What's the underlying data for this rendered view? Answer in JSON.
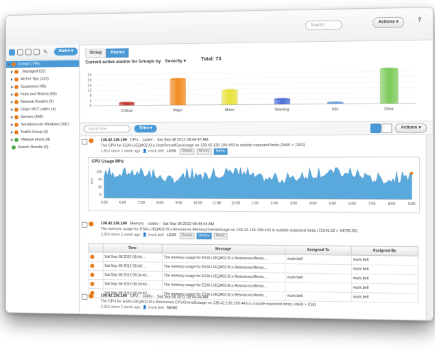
{
  "top": {
    "search_placeholder": "Search",
    "actions_label": "Actions",
    "help_label": "?"
  },
  "left": {
    "name_button": "Name",
    "tree": [
      {
        "label": "Groups (799)",
        "color": "#e67c1e",
        "selected": true
      },
      {
        "label": "_Managed (12)",
        "color": "#e67c1e"
      },
      {
        "label": "All For Tips (332)",
        "color": "#e67c1e"
      },
      {
        "label": "Customers (46)",
        "color": "#e67c1e"
      },
      {
        "label": "Hubs and Robots (55)",
        "color": "#e67c1e"
      },
      {
        "label": "Network Routers (9)",
        "color": "#e67c1e"
      },
      {
        "label": "Origin NOT cadev (4)",
        "color": "#e67c1e"
      },
      {
        "label": "Servers (398)",
        "color": "#e67c1e"
      },
      {
        "label": "Servidores de Windows (301)",
        "color": "#e67c1e"
      },
      {
        "label": "Todd's Group (3)",
        "color": "#e67c1e"
      },
      {
        "label": "VMware Hosts (4)",
        "color": "#4aa84a"
      },
      {
        "label": "Search Results (0)",
        "color": "#4aa84a"
      }
    ]
  },
  "tabs": [
    "Group",
    "Alarms"
  ],
  "chart_title": "Current active alarms for Groups by",
  "severity_label": "Severity",
  "total_label": "Total: 73",
  "chart_data": {
    "type": "bar",
    "categories": [
      "Critical",
      "Major",
      "Minor",
      "Warning",
      "Info",
      "Clear"
    ],
    "values": [
      2,
      20,
      11,
      4,
      1,
      26
    ],
    "colors": [
      "#c0392b",
      "#f08a1e",
      "#e8e23a",
      "#4c6fd8",
      "#6aa2e0",
      "#7ccb5a"
    ],
    "yticks": [
      24,
      20,
      16,
      12,
      8,
      4,
      0
    ],
    "ylim": [
      0,
      28
    ]
  },
  "filter": {
    "placeholder": "Quick Filter",
    "time_button": "Time",
    "actions_label": "Actions"
  },
  "alarms": [
    {
      "ip": "138.42.136.199",
      "type": "CPU",
      "origin": "cadev",
      "time": "Sat Sep 08 2012 08:44:47 AM",
      "message": "The CPU for ESXi-LIEQA02.l9.x.HostOverallCpuUsage on 138.42.136.199:443 is outside expected limits (9460 > 1303)",
      "meta": "2,812 since 1 week ago",
      "user": "mark.bell",
      "buttons": [
        "LESS",
        "Details",
        "History",
        "Metric"
      ]
    },
    {
      "ip": "138.42.136.199",
      "type": "Memory",
      "origin": "cadev",
      "time": "Sat Sep 08 2012 08:44:44 AM",
      "message": "The memory usage for ESXi-LIEQA02.l9.x.Resources.MemoryOverallUsage on 138.42.136.199:443 is outside expected limits (73143.32 > 34796.26)",
      "meta": "2,812 since 1 week ago",
      "user": "mark.bell",
      "buttons": [
        "LESS",
        "Details",
        "History",
        "Metric"
      ]
    },
    {
      "ip": "138.42.136.199",
      "type": "CPU",
      "origin": "cadev",
      "time": "Sat Sep 08 2012 08:44:44 AM",
      "message": "The CPU for ESXi-LIEQA02.l9.x.Resources.CPUOverallUsage on 138.42.136.199:443 is outside expected limits (4840 > 918)",
      "meta": "2,812 since 1 week ago",
      "user": "mark.bell",
      "buttons": [
        "MORE"
      ]
    }
  ],
  "metric": {
    "title": "CPU Usage MHz",
    "ylabel": "MHz",
    "yticks": [
      "10k",
      "9k",
      "8k",
      "7k"
    ],
    "xticks": [
      "5:00",
      "6:00",
      "7:00",
      "8:00",
      "9:00",
      "10:00",
      "11:00",
      "12:00",
      "1:00",
      "2:00",
      "3:00",
      "4:00",
      "5:00",
      "6:00",
      "7:00",
      "8:00",
      "9:00"
    ]
  },
  "history": {
    "headers": [
      "Time",
      "Message",
      "Assigned To",
      "Assigned By"
    ],
    "rows": [
      [
        "Sat Sep 08 2012 08:44:...",
        "The memory usage for ESXi-LIEQA02.l9.x.Resources.Memo...",
        "mark.bell",
        "mark.bell"
      ],
      [
        "Sat Sep 08 2012 08:40:...",
        "The memory usage for ESXi-LIEQA02.l9.x.Resources.Memo...",
        "",
        "mark.bell"
      ],
      [
        "Sat Sep 08 2012 08:34:42...",
        "The memory usage for ESXi-LIEQA02.l9.x.Resources.Memo...",
        "mark.bell",
        "mark.bell"
      ],
      [
        "Sat Sep 08 2012 08:29:42...",
        "The memory usage for ESXi-LIEQA02.l9.x.Resources.Memo...",
        "",
        "mark.bell"
      ],
      [
        "Sat Sep 08 2012 08:24:42...",
        "The memory usage for ESXi-LIEQA02.l9.x.Resources.Memo...",
        "mark.bell",
        "mark.bell"
      ]
    ]
  }
}
